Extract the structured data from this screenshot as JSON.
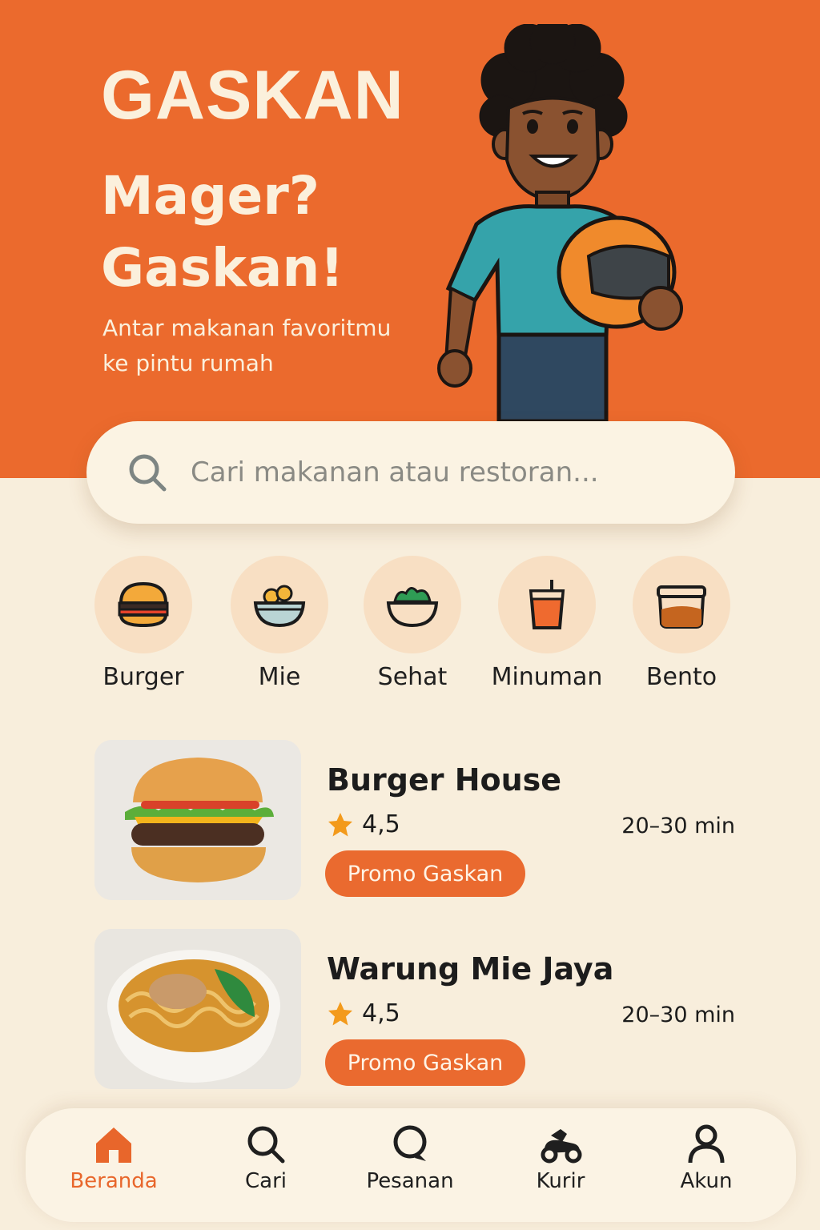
{
  "hero": {
    "brand": "GASKAN",
    "headline_line1": "Mager?",
    "headline_line2": "Gaskan!",
    "tagline_line1": "Antar makanan favoritmu",
    "tagline_line2": "ke pintu rumah",
    "illustration": "courier-with-helmet"
  },
  "search": {
    "placeholder": "Cari makanan atau restoran...",
    "icon": "search-icon"
  },
  "categories": [
    {
      "label": "Burger",
      "icon": "burger-icon"
    },
    {
      "label": "Mie",
      "icon": "noodle-bowl-icon"
    },
    {
      "label": "Sehat",
      "icon": "salad-bowl-icon"
    },
    {
      "label": "Minuman",
      "icon": "drink-icon"
    },
    {
      "label": "Bento",
      "icon": "bento-box-icon"
    }
  ],
  "restaurants": [
    {
      "name": "Burger House",
      "rating": "4,5",
      "time": "20–30 min",
      "promo": "Promo Gaskan",
      "image": "burger-photo"
    },
    {
      "name": "Warung Mie Jaya",
      "rating": "4,5",
      "time": "20–30 min",
      "promo": "Promo Gaskan",
      "image": "noodle-photo"
    }
  ],
  "nav": [
    {
      "label": "Beranda",
      "icon": "home-icon",
      "active": true
    },
    {
      "label": "Cari",
      "icon": "search-icon",
      "active": false
    },
    {
      "label": "Pesanan",
      "icon": "orders-icon",
      "active": false
    },
    {
      "label": "Kurir",
      "icon": "scooter-icon",
      "active": false
    },
    {
      "label": "Akun",
      "icon": "user-icon",
      "active": false
    }
  ],
  "colors": {
    "brand_orange": "#eb6a2d",
    "cream": "#f8eedc",
    "category_bg": "#f8dfc3",
    "promo": "#ea6a2f"
  }
}
